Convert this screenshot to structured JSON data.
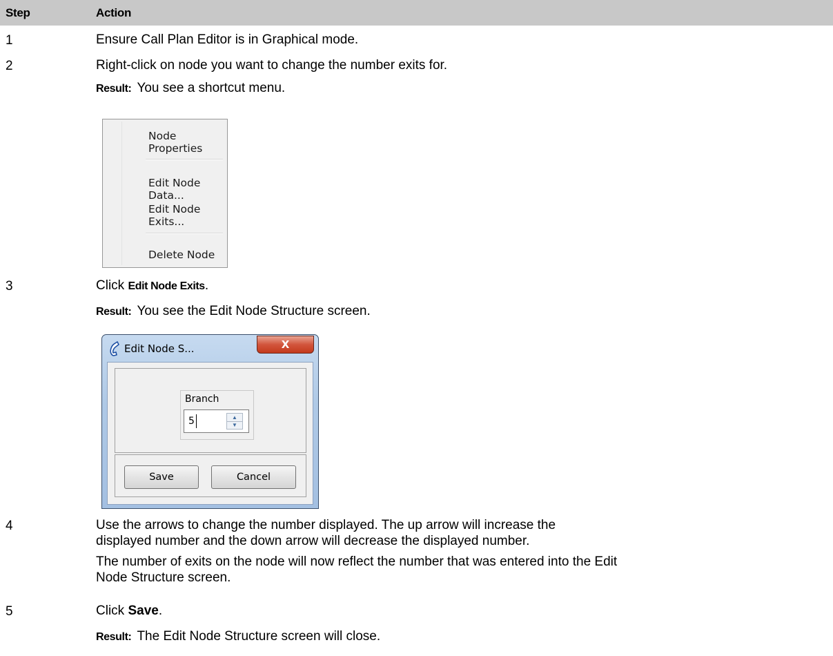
{
  "table": {
    "headers": {
      "step": "Step",
      "action": "Action"
    },
    "rows": [
      {
        "step": "1",
        "text": "Ensure Call Plan Editor is in Graphical mode."
      },
      {
        "step": "2",
        "text": "Right-click on node you want to change the number exits for.",
        "result_label": "Result:",
        "result_text": "You see a shortcut menu."
      },
      {
        "step": "3",
        "text_prefix": "Click ",
        "text_bold": "Edit Node Exits",
        "text_suffix": ".",
        "result_label": "Result:",
        "result_text": "You see the Edit Node Structure screen."
      },
      {
        "step": "4",
        "text_line1": "Use the arrows to change the number displayed.   The up arrow will increase the",
        "text_line2": "displayed number and the down arrow will decrease the displayed number.",
        "text2_line1": "The number of exits on the node will now reflect the number that was entered into the Edit",
        "text2_line2": "Node Structure screen."
      },
      {
        "step": "5",
        "text_prefix": "Click ",
        "text_bold": "Save",
        "text_suffix": ".",
        "result_label": "Result:",
        "result_text": "The Edit Node Structure screen will close."
      }
    ]
  },
  "context_menu": {
    "items": [
      "Node Properties",
      "Edit Node Data...",
      "Edit Node Exits...",
      "Delete Node"
    ]
  },
  "dialog": {
    "title": "Edit Node S...",
    "close_glyph": "X",
    "branch_label": "Branch",
    "branch_value": "5",
    "save_label": "Save",
    "cancel_label": "Cancel",
    "icon": "phone-handset-icon"
  }
}
